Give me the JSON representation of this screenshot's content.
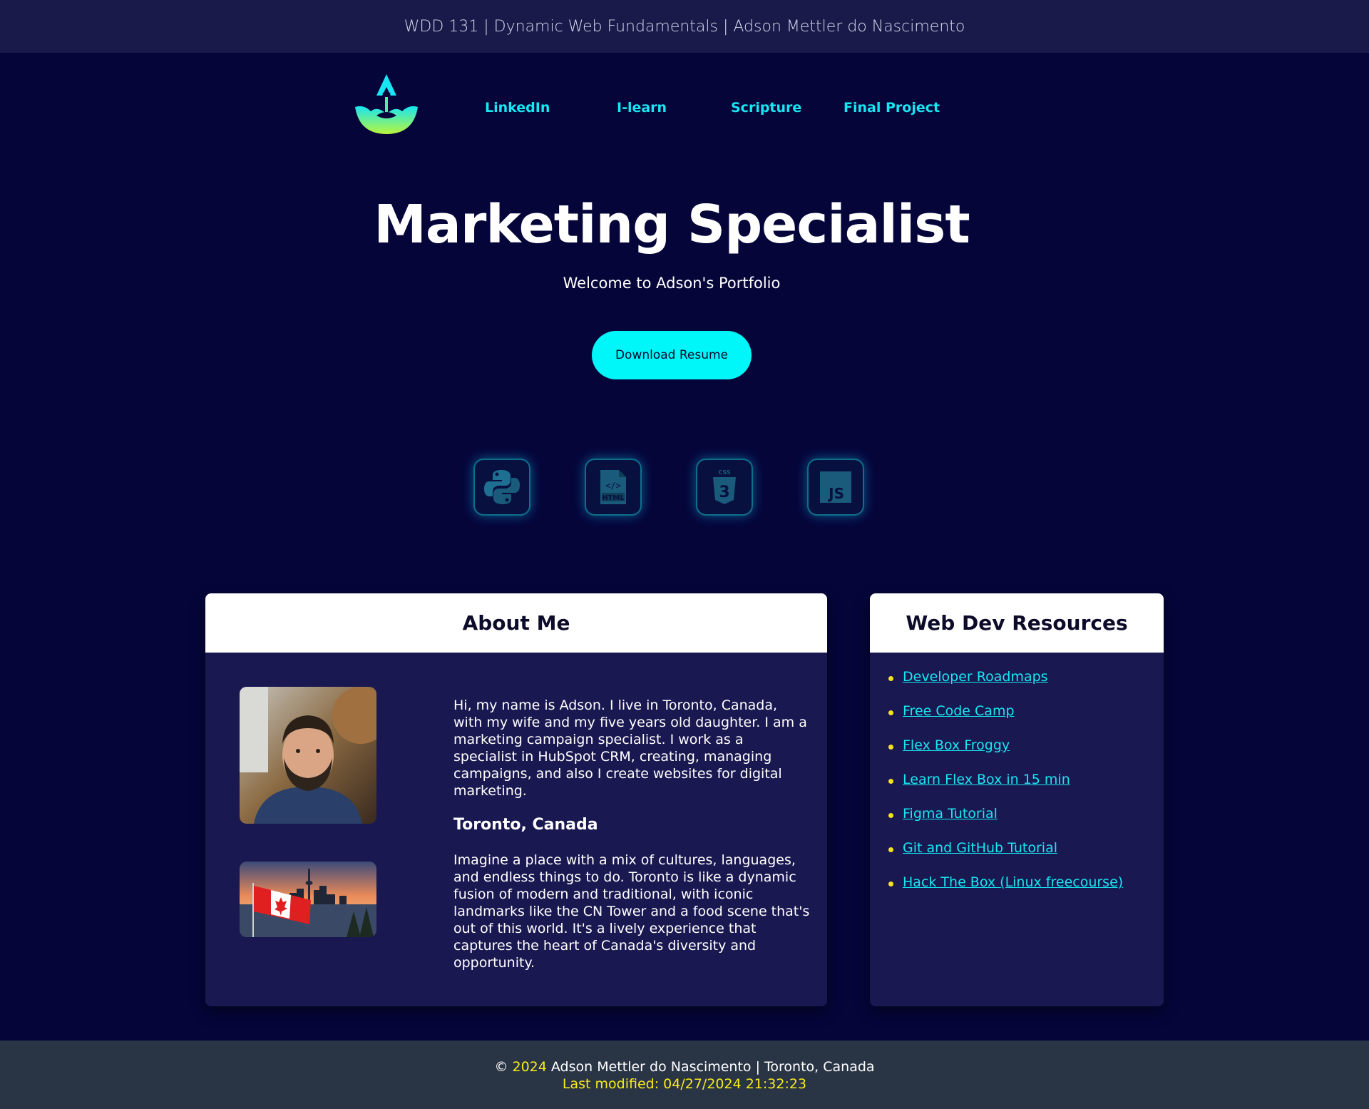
{
  "topbar": {
    "text": "WDD 131 | Dynamic Web Fundamentals | Adson Mettler do Nascimento"
  },
  "nav": {
    "logo": "logo-icon",
    "links": [
      "LinkedIn",
      "I-learn",
      "Scripture",
      "Final Project"
    ]
  },
  "hero": {
    "title": "Marketing Specialist",
    "subtitle": "Welcome to Adson's Portfolio",
    "button": "Download Resume"
  },
  "skills": [
    {
      "icon": "python-icon"
    },
    {
      "icon": "html-icon",
      "label": "HTML"
    },
    {
      "icon": "css3-icon",
      "label": "CSS",
      "num": "3"
    },
    {
      "icon": "javascript-icon",
      "label": "JS"
    }
  ],
  "about": {
    "heading": "About Me",
    "intro": "Hi, my name is Adson. I live in Toronto, Canada, with my wife and my five years old daughter. I am a marketing campaign specialist. I work as a specialist in HubSpot CRM, creating, managing campaigns, and also I create websites for digital marketing.",
    "location_heading": "Toronto, Canada",
    "location_text": "Imagine a place with a mix of cultures, languages, and endless things to do. Toronto is like a dynamic fusion of modern and traditional, with iconic landmarks like the CN Tower and a food scene that's out of this world. It's a lively experience that captures the heart of Canada's diversity and opportunity."
  },
  "resources": {
    "heading": "Web Dev Resources",
    "links": [
      "Developer Roadmaps",
      "Free Code Camp",
      "Flex Box Froggy",
      "Learn Flex Box in 15 min",
      "Figma Tutorial",
      "Git and GitHub Tutorial",
      "Hack The Box (Linux freecourse)"
    ]
  },
  "footer": {
    "copyright_symbol": "©",
    "year": "2024",
    "line1_rest": "Adson Mettler do Nascimento | Toronto, Canada",
    "last_modified": "Last modified: 04/27/2024 21:32:23"
  },
  "colors": {
    "background": "#05053a",
    "accent_cyan": "#00f7fa",
    "link_cyan": "#18e6f2",
    "highlight_yellow": "#f7ec1a",
    "card_body": "#1a1850",
    "footer_bg": "#293444"
  }
}
